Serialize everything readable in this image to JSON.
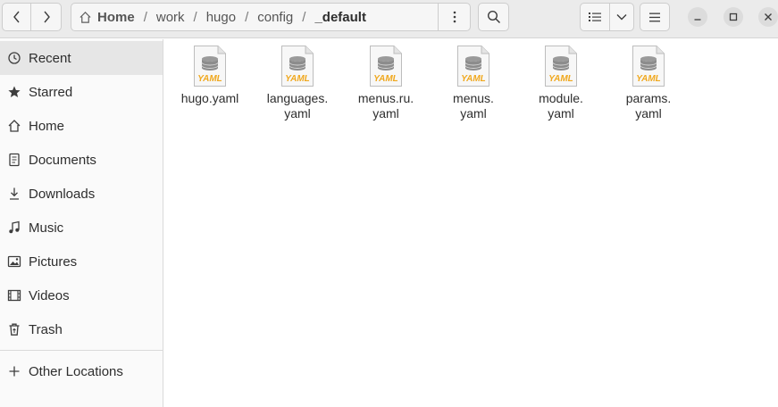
{
  "path": {
    "home_label": "Home",
    "separator": "/",
    "crumbs": [
      "work",
      "hugo",
      "config"
    ],
    "current": "_default"
  },
  "sidebar": {
    "items": [
      {
        "label": "Recent",
        "icon": "clock-icon"
      },
      {
        "label": "Starred",
        "icon": "star-icon"
      },
      {
        "label": "Home",
        "icon": "home-icon"
      },
      {
        "label": "Documents",
        "icon": "document-icon"
      },
      {
        "label": "Downloads",
        "icon": "download-icon"
      },
      {
        "label": "Music",
        "icon": "music-icon"
      },
      {
        "label": "Pictures",
        "icon": "picture-icon"
      },
      {
        "label": "Videos",
        "icon": "video-icon"
      },
      {
        "label": "Trash",
        "icon": "trash-icon"
      }
    ],
    "other_locations": {
      "label": "Other Locations",
      "icon": "plus-icon"
    }
  },
  "files": [
    {
      "line1": "hugo.yaml",
      "line2": "",
      "badge": "YAML"
    },
    {
      "line1": "languages.",
      "line2": "yaml",
      "badge": "YAML"
    },
    {
      "line1": "menus.ru.",
      "line2": "yaml",
      "badge": "YAML"
    },
    {
      "line1": "menus.",
      "line2": "yaml",
      "badge": "YAML"
    },
    {
      "line1": "module.",
      "line2": "yaml",
      "badge": "YAML"
    },
    {
      "line1": "params.",
      "line2": "yaml",
      "badge": "YAML"
    }
  ],
  "colors": {
    "yaml_badge": "#f0a81e",
    "db_gray": "#8c8c8c"
  }
}
